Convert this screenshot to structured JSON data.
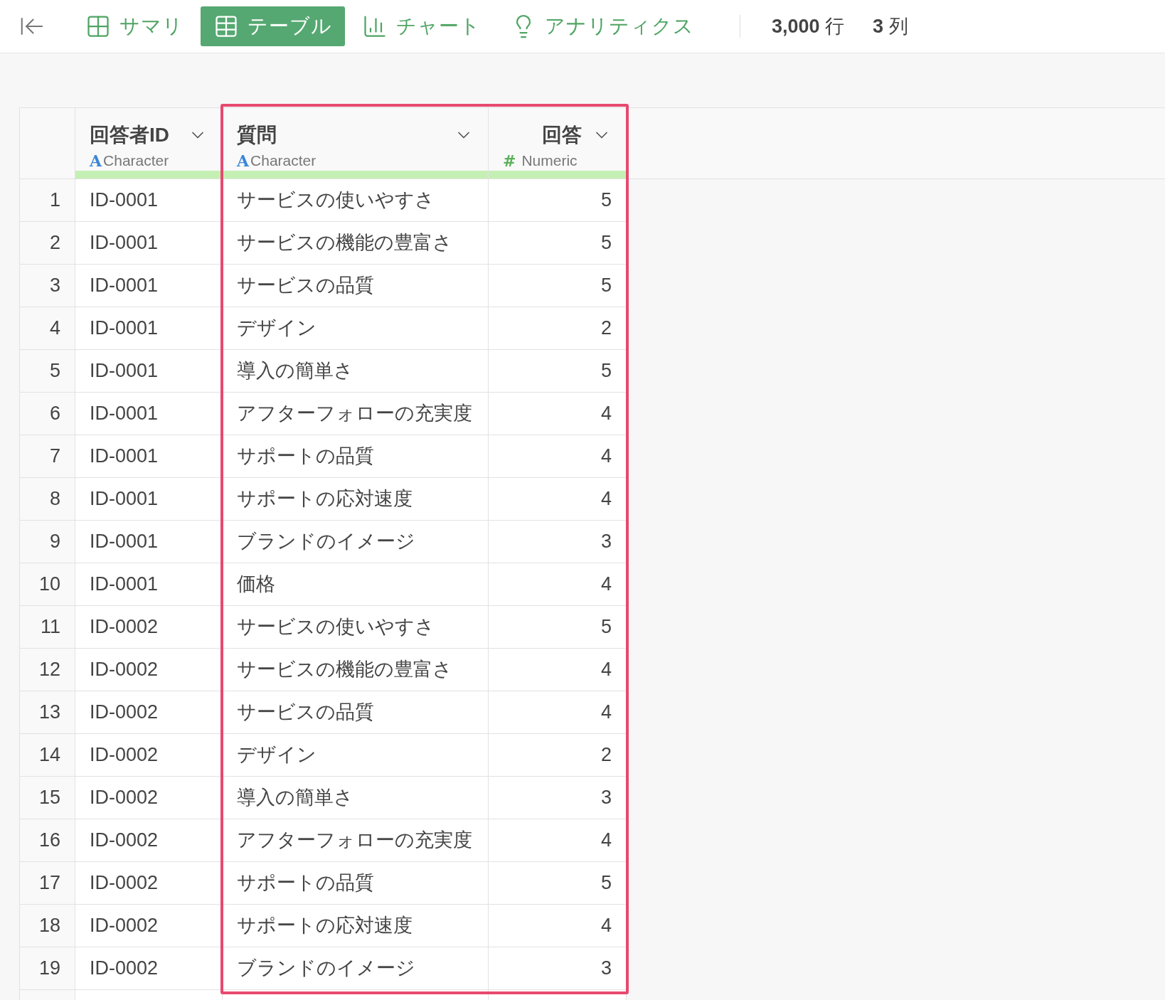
{
  "toolbar": {
    "tabs": [
      {
        "kind": "summary",
        "label": "サマリ",
        "selected": false
      },
      {
        "kind": "table",
        "label": "テーブル",
        "selected": true
      },
      {
        "kind": "chart",
        "label": "チャート",
        "selected": false
      },
      {
        "kind": "analytics",
        "label": "アナリティクス",
        "selected": false
      }
    ],
    "stats": [
      {
        "value": "3,000",
        "unit": "行"
      },
      {
        "value": "3",
        "unit": "列"
      }
    ]
  },
  "table": {
    "columns": [
      {
        "label": "回答者ID",
        "kind": "character",
        "type_icon": "A",
        "type": "Character",
        "highlighted": false
      },
      {
        "label": "質問",
        "kind": "character",
        "type_icon": "A",
        "type": "Character",
        "highlighted": true
      },
      {
        "label": "回答",
        "kind": "numeric",
        "type_icon": "#",
        "type": "Numeric",
        "highlighted": true
      }
    ],
    "rows": [
      {
        "number": "1",
        "cells": [
          "ID-0001",
          "サービスの使いやすさ",
          "5"
        ]
      },
      {
        "number": "2",
        "cells": [
          "ID-0001",
          "サービスの機能の豊富さ",
          "5"
        ]
      },
      {
        "number": "3",
        "cells": [
          "ID-0001",
          "サービスの品質",
          "5"
        ]
      },
      {
        "number": "4",
        "cells": [
          "ID-0001",
          "デザイン",
          "2"
        ]
      },
      {
        "number": "5",
        "cells": [
          "ID-0001",
          "導入の簡単さ",
          "5"
        ]
      },
      {
        "number": "6",
        "cells": [
          "ID-0001",
          "アフターフォローの充実度",
          "4"
        ]
      },
      {
        "number": "7",
        "cells": [
          "ID-0001",
          "サポートの品質",
          "4"
        ]
      },
      {
        "number": "8",
        "cells": [
          "ID-0001",
          "サポートの応対速度",
          "4"
        ]
      },
      {
        "number": "9",
        "cells": [
          "ID-0001",
          "ブランドのイメージ",
          "3"
        ]
      },
      {
        "number": "10",
        "cells": [
          "ID-0001",
          "価格",
          "4"
        ]
      },
      {
        "number": "11",
        "cells": [
          "ID-0002",
          "サービスの使いやすさ",
          "5"
        ]
      },
      {
        "number": "12",
        "cells": [
          "ID-0002",
          "サービスの機能の豊富さ",
          "4"
        ]
      },
      {
        "number": "13",
        "cells": [
          "ID-0002",
          "サービスの品質",
          "4"
        ]
      },
      {
        "number": "14",
        "cells": [
          "ID-0002",
          "デザイン",
          "2"
        ]
      },
      {
        "number": "15",
        "cells": [
          "ID-0002",
          "導入の簡単さ",
          "3"
        ]
      },
      {
        "number": "16",
        "cells": [
          "ID-0002",
          "アフターフォローの充実度",
          "4"
        ]
      },
      {
        "number": "17",
        "cells": [
          "ID-0002",
          "サポートの品質",
          "5"
        ]
      },
      {
        "number": "18",
        "cells": [
          "ID-0002",
          "サポートの応対速度",
          "4"
        ]
      },
      {
        "number": "19",
        "cells": [
          "ID-0002",
          "ブランドのイメージ",
          "3"
        ]
      }
    ]
  }
}
